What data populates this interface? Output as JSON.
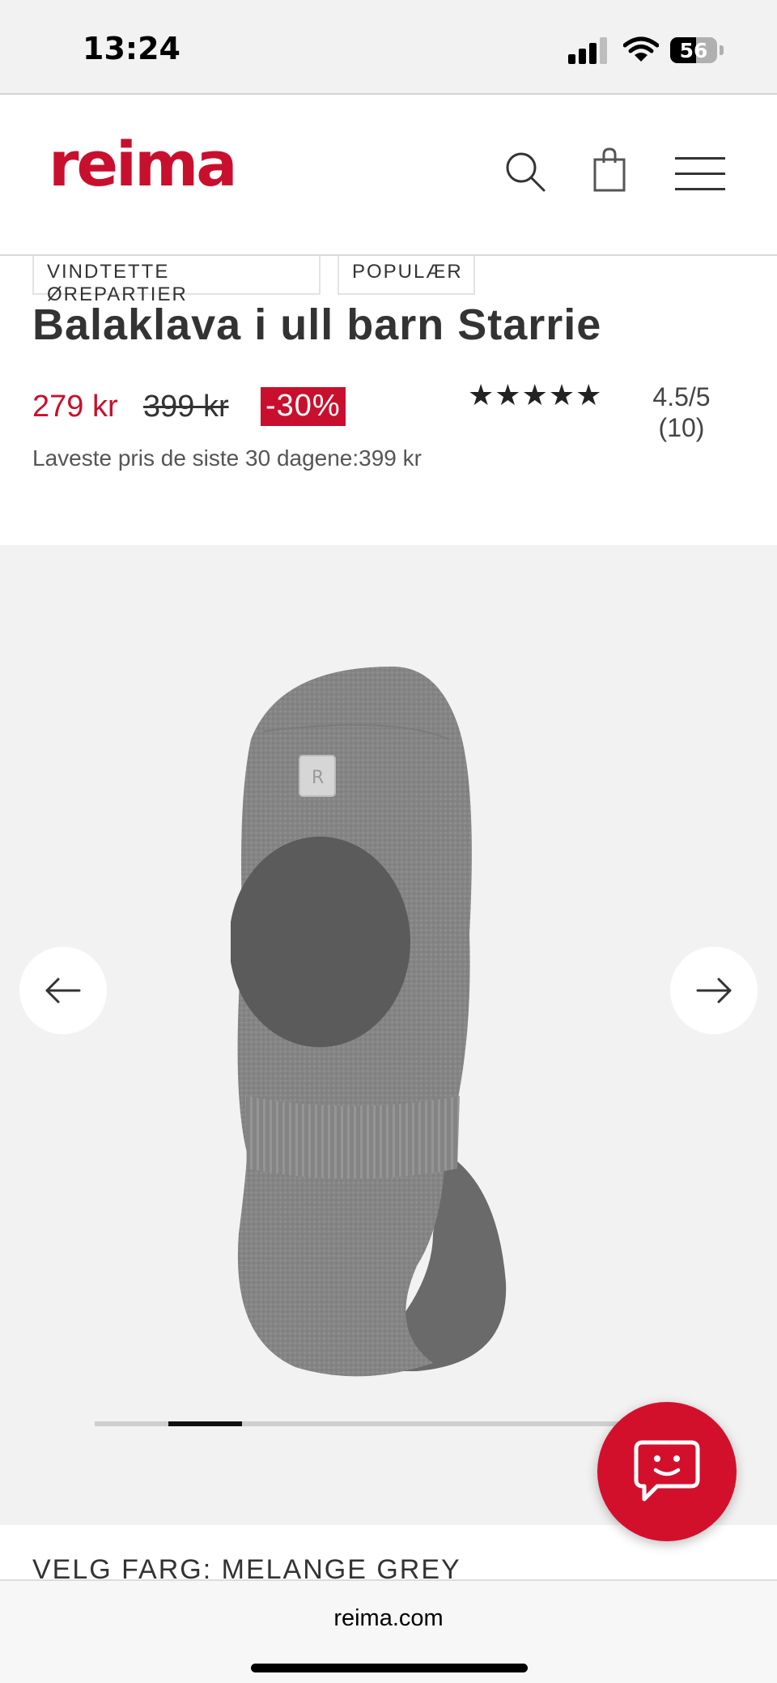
{
  "status_bar": {
    "time": "13:24",
    "battery_level": "56",
    "battery_fraction": 0.56,
    "signal_bars_active": 3,
    "signal_bars_total": 4
  },
  "header": {
    "logo_text": "reima",
    "brand_color": "#c8102e",
    "icons": [
      "search-icon",
      "shopping-bag-icon",
      "hamburger-menu-icon"
    ]
  },
  "product": {
    "tags": [
      "VINDTETTE ØREPARTIER",
      "POPULÆR"
    ],
    "title": "Balaklava i ull barn Starrie",
    "price_current": "279 kr",
    "price_original": "399 kr",
    "discount": "-30%",
    "lowest_price_note": "Laveste pris de siste 30 dagene:399 kr",
    "rating": {
      "score": "4.5/5",
      "count": "(10)",
      "stars_filled": 5,
      "stars_total": 5
    },
    "color_label": "VELG FARG: MELANGE GREY"
  },
  "gallery": {
    "slides_total": 8,
    "active_slide": 2,
    "prev_icon": "arrow-left-icon",
    "next_icon": "arrow-right-icon"
  },
  "chat": {
    "icon": "chat-smile-icon",
    "color": "#d3102c"
  },
  "browser": {
    "url": "reima.com"
  }
}
